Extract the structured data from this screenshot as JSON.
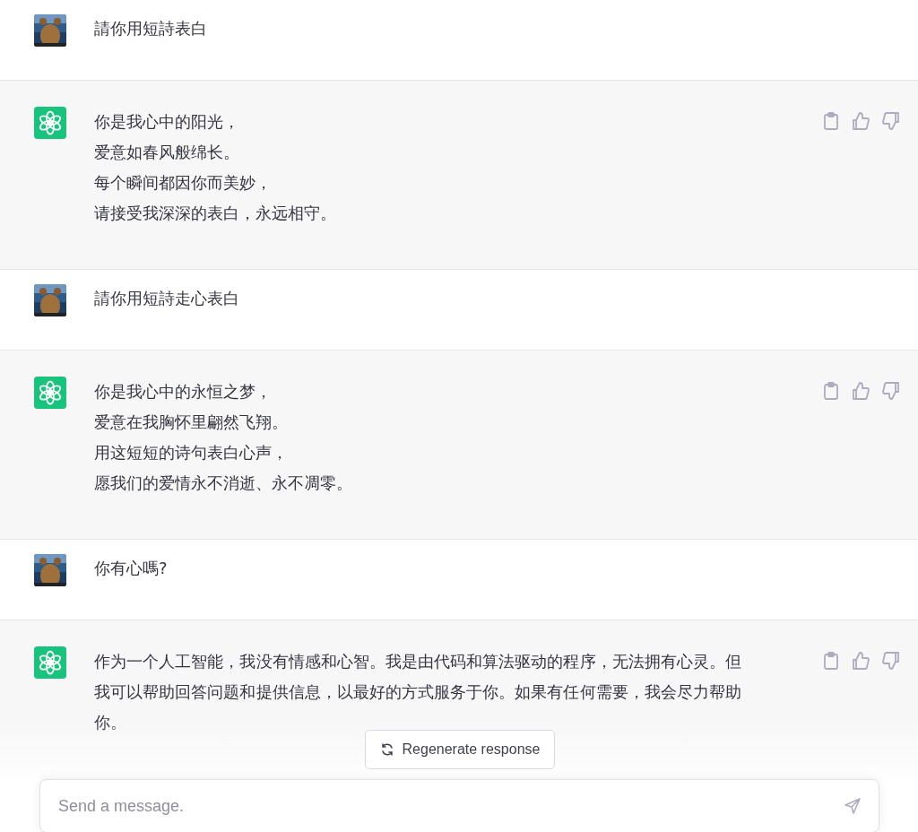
{
  "messages": [
    {
      "kind": "user",
      "lines": [
        "請你用短詩表白"
      ]
    },
    {
      "kind": "assistant",
      "lines": [
        "你是我心中的阳光，",
        "爱意如春风般绵长。",
        "每个瞬间都因你而美妙，",
        "请接受我深深的表白，永远相守。"
      ]
    },
    {
      "kind": "user",
      "lines": [
        "請你用短詩走心表白"
      ]
    },
    {
      "kind": "assistant",
      "lines": [
        "你是我心中的永恒之梦，",
        "爱意在我胸怀里翩然飞翔。",
        "用这短短的诗句表白心声，",
        "愿我们的爱情永不消逝、永不凋零。"
      ]
    },
    {
      "kind": "user",
      "lines": [
        "你有心嗎?"
      ]
    },
    {
      "kind": "assistant",
      "lines": [
        "作为一个人工智能，我没有情感和心智。我是由代码和算法驱动的程序，无法拥有心灵。但我可以帮助回答问题和提供信息，以最好的方式服务于你。如果有任何需要，我会尽力帮助你。"
      ]
    }
  ],
  "regenerate_button": "Regenerate response",
  "composer": {
    "placeholder": "Send a message."
  }
}
